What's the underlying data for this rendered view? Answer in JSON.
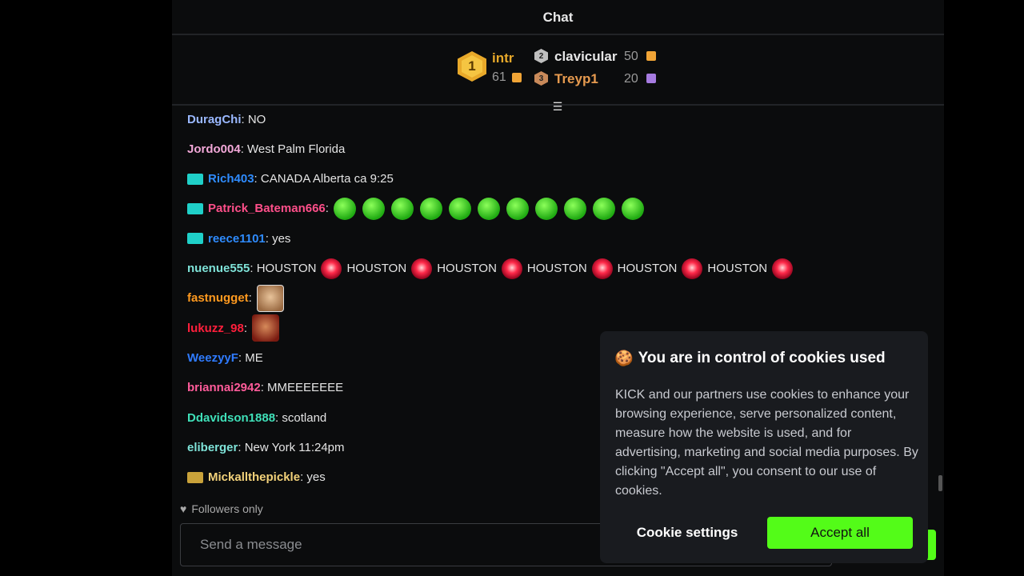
{
  "chat_header": {
    "title": "Chat"
  },
  "leaderboard": {
    "first": {
      "rank": "1",
      "name": "intr",
      "count": "61",
      "color": "#e8a92a"
    },
    "second": {
      "rank": "2",
      "name": "clavicular",
      "count": "50"
    },
    "third": {
      "rank": "3",
      "name": "Treyp1",
      "count": "20"
    }
  },
  "messages": [
    {
      "user": "DuragChi",
      "user_color": "#9ab8ff",
      "text": ": NO"
    },
    {
      "user": "Jordo004",
      "user_color": "#f2a8d8",
      "text": ": West Palm Florida"
    },
    {
      "user": "Rich403",
      "user_color": "#2f8cff",
      "text": ": CANADA Alberta ca 9:25",
      "badge": "badge-icon"
    },
    {
      "user": "Patrick_Bateman666",
      "user_color": "#ff4f8a",
      "text": ":",
      "badge": "badge-icon",
      "emote": "green-emote-icon",
      "emote_count": 11
    },
    {
      "user": "reece1101",
      "user_color": "#2f8cff",
      "text": ": yes",
      "badge": "badge-icon"
    },
    {
      "user": "nuenue555",
      "user_color": "#7fe3d8",
      "text": ": HOUSTON",
      "word": "HOUSTON"
    },
    {
      "user": "fastnugget",
      "user_color": "#ff9a1f",
      "text": ":"
    },
    {
      "user": "lukuzz_98",
      "user_color": "#ff1f3c",
      "text": ":"
    },
    {
      "user": "WeezyyF",
      "user_color": "#2f7bff",
      "text": ": ME"
    },
    {
      "user": "briannai2942",
      "user_color": "#ff5c9a",
      "text": ": MMEEEEEEE"
    },
    {
      "user": "Ddavidson1888",
      "user_color": "#3fe0b8",
      "text": ": scotland"
    },
    {
      "user": "eliberger",
      "user_color": "#7fe3d8",
      "text": ": New York 11:24pm"
    },
    {
      "user": "Mickallthepickle",
      "user_color": "#f3d27a",
      "text": ": yes",
      "badge": "gold-badge-icon"
    }
  ],
  "footer": {
    "followers_only": "Followers only",
    "input_placeholder": "Send a message"
  },
  "cookie_banner": {
    "title": "You are in control of cookies used",
    "body": "KICK and our partners use cookies to enhance your browsing experience, serve personalized content, measure how the website is used, and for advertising, marketing and social media purposes. By clicking \"Accept all\", you consent to our use of cookies.",
    "settings_label": "Cookie settings",
    "accept_label": "Accept all",
    "accent_color": "#53fc18"
  }
}
